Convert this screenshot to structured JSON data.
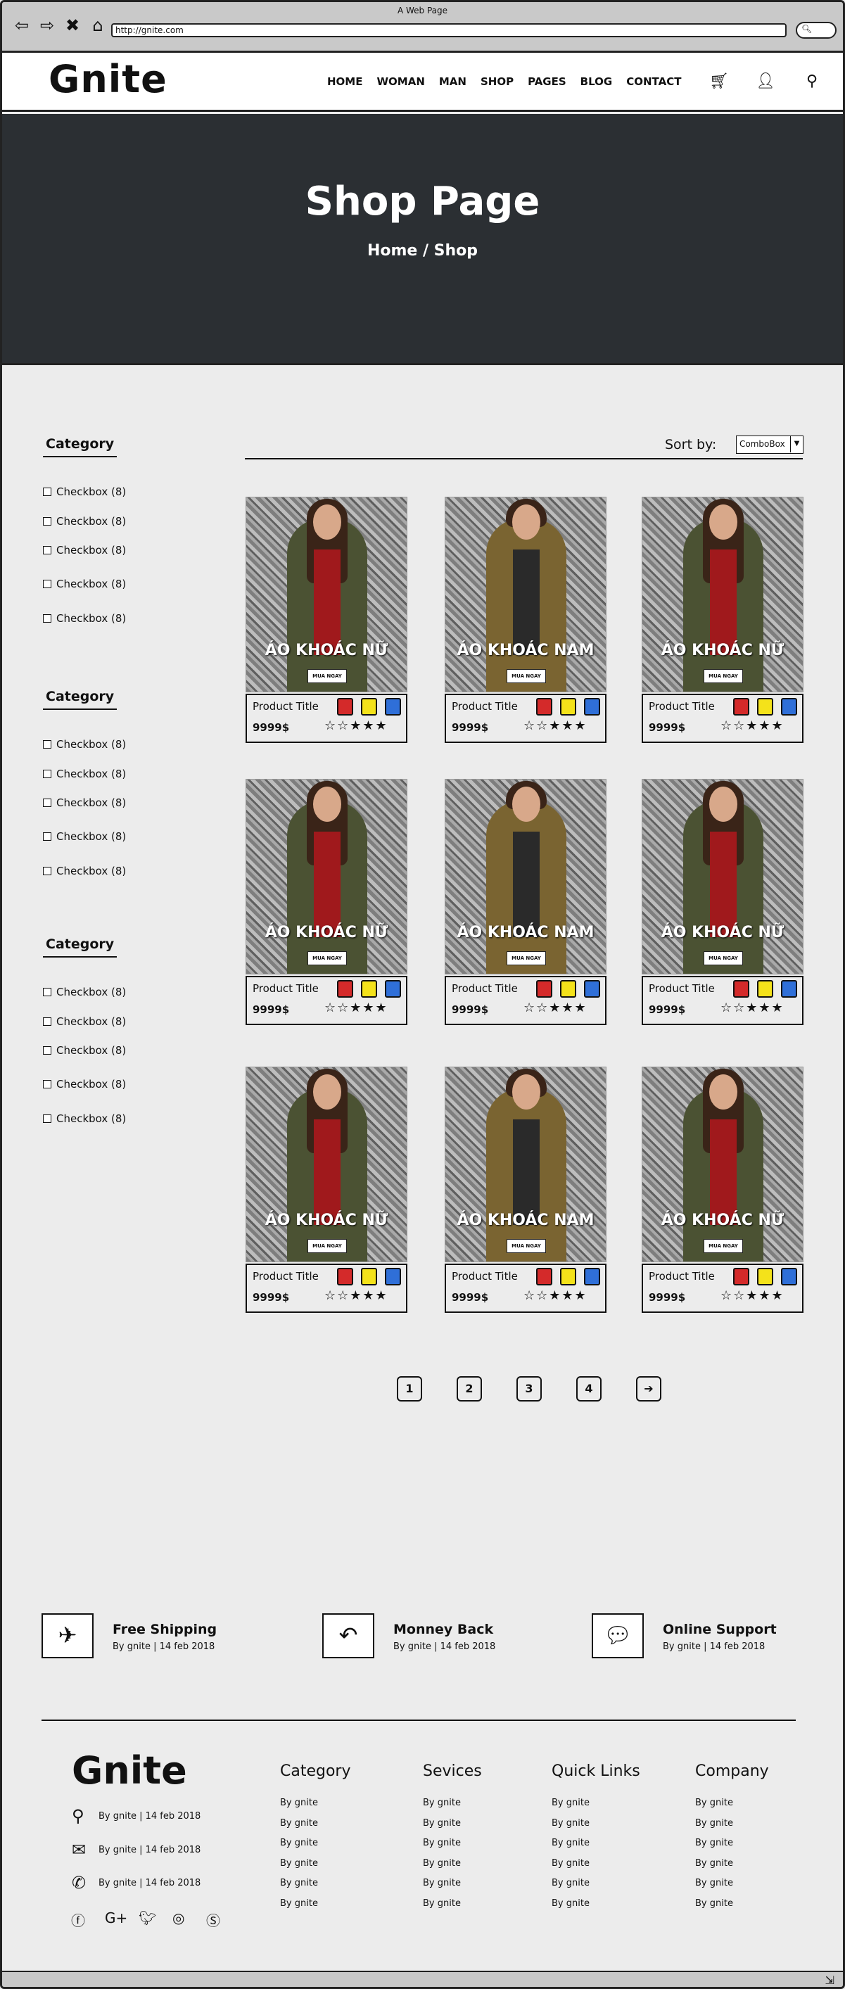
{
  "window": {
    "title": "A Web Page",
    "url": "http://gnite.com"
  },
  "header": {
    "logo": "Gnite",
    "menu": [
      "HOME",
      "WOMAN",
      "MAN",
      "SHOP",
      "PAGES",
      "BLOG",
      "CONTACT"
    ]
  },
  "hero": {
    "title": "Shop Page",
    "breadcrumb": "Home / Shop"
  },
  "sidebar": {
    "categories": [
      {
        "title": "Category",
        "items": [
          "Checkbox (8)",
          "Checkbox (8)",
          "Checkbox (8)",
          "Checkbox (8)",
          "Checkbox (8)"
        ]
      },
      {
        "title": "Category",
        "items": [
          "Checkbox (8)",
          "Checkbox (8)",
          "Checkbox (8)",
          "Checkbox (8)",
          "Checkbox (8)"
        ]
      },
      {
        "title": "Category",
        "items": [
          "Checkbox (8)",
          "Checkbox (8)",
          "Checkbox (8)",
          "Checkbox (8)",
          "Checkbox (8)"
        ]
      }
    ]
  },
  "sort": {
    "label": "Sort by:",
    "value": "ComboBox"
  },
  "products": [
    {
      "caption": "ÁO KHOÁC NỮ",
      "buy": "MUA NGAY",
      "title": "Product Title",
      "price": "9999$",
      "stars": "☆☆★★★",
      "person": "woman"
    },
    {
      "caption": "ÁO KHOÁC NAM",
      "buy": "MUA NGAY",
      "title": "Product Title",
      "price": "9999$",
      "stars": "☆☆★★★",
      "person": "man"
    },
    {
      "caption": "ÁO KHOÁC NỮ",
      "buy": "MUA NGAY",
      "title": "Product Title",
      "price": "9999$",
      "stars": "☆☆★★★",
      "person": "woman"
    },
    {
      "caption": "ÁO KHOÁC NỮ",
      "buy": "MUA NGAY",
      "title": "Product Title",
      "price": "9999$",
      "stars": "☆☆★★★",
      "person": "woman"
    },
    {
      "caption": "ÁO KHOÁC NAM",
      "buy": "MUA NGAY",
      "title": "Product Title",
      "price": "9999$",
      "stars": "☆☆★★★",
      "person": "man"
    },
    {
      "caption": "ÁO KHOÁC NỮ",
      "buy": "MUA NGAY",
      "title": "Product Title",
      "price": "9999$",
      "stars": "☆☆★★★",
      "person": "woman"
    },
    {
      "caption": "ÁO KHOÁC NỮ",
      "buy": "MUA NGAY",
      "title": "Product Title",
      "price": "9999$",
      "stars": "☆☆★★★",
      "person": "woman"
    },
    {
      "caption": "ÁO KHOÁC NAM",
      "buy": "MUA NGAY",
      "title": "Product Title",
      "price": "9999$",
      "stars": "☆☆★★★",
      "person": "man"
    },
    {
      "caption": "ÁO KHOÁC NỮ",
      "buy": "MUA NGAY",
      "title": "Product Title",
      "price": "9999$",
      "stars": "☆☆★★★",
      "person": "woman"
    }
  ],
  "swatch_colors": [
    "#d42a2a",
    "#f4e21a",
    "#2f6fd8"
  ],
  "pagination": [
    "1",
    "2",
    "3",
    "4"
  ],
  "features": [
    {
      "icon": "airplane-icon",
      "title": "Free Shipping",
      "sub": "By gnite | 14 feb 2018"
    },
    {
      "icon": "reply-arrow-icon",
      "title": "Monney Back",
      "sub": "By gnite | 14 feb 2018"
    },
    {
      "icon": "chat-bubble-icon",
      "title": "Online Support",
      "sub": "By gnite | 14 feb 2018"
    }
  ],
  "footer": {
    "logo": "Gnite",
    "contacts": [
      {
        "icon": "map-marker-icon",
        "text": "By gnite | 14 feb 2018"
      },
      {
        "icon": "envelope-icon",
        "text": "By gnite | 14 feb 2018"
      },
      {
        "icon": "phone-icon",
        "text": "By gnite | 14 feb 2018"
      }
    ],
    "social": [
      "facebook-icon",
      "google-plus-icon",
      "twitter-icon",
      "instagram-icon",
      "skype-icon"
    ],
    "columns": [
      {
        "title": "Category",
        "links": [
          "By gnite",
          "By gnite",
          "By gnite",
          "By gnite",
          "By gnite",
          "By gnite"
        ]
      },
      {
        "title": "Sevices",
        "links": [
          "By gnite",
          "By gnite",
          "By gnite",
          "By gnite",
          "By gnite",
          "By gnite"
        ]
      },
      {
        "title": "Quick Links",
        "links": [
          "By gnite",
          "By gnite",
          "By gnite",
          "By gnite",
          "By gnite",
          "By gnite"
        ]
      },
      {
        "title": "Company",
        "links": [
          "By gnite",
          "By gnite",
          "By gnite",
          "By gnite",
          "By gnite",
          "By gnite"
        ]
      }
    ]
  }
}
